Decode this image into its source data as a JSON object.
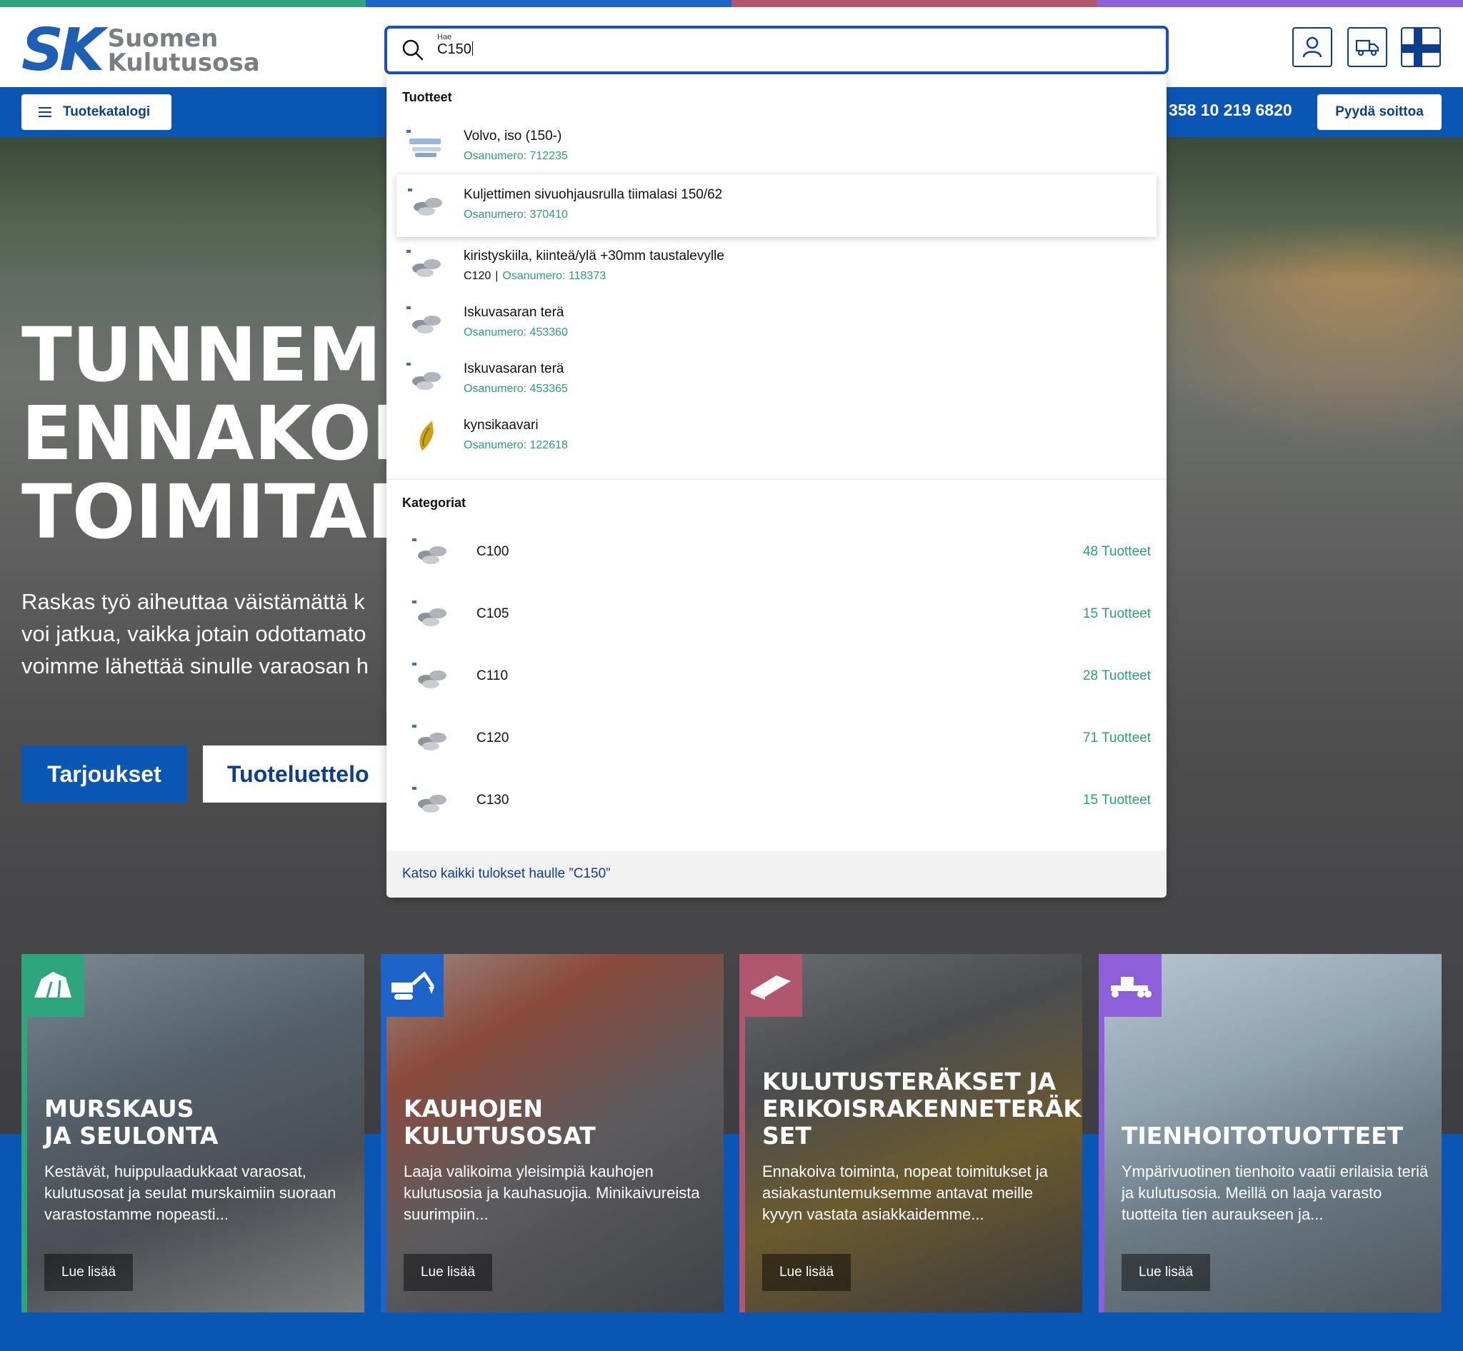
{
  "colors": {
    "stripe": [
      "#2fa57e",
      "#1d63c8",
      "#b0566e",
      "#8d5fd9"
    ],
    "brand_blue": "#0a56b4",
    "accent_green": "#2aa077",
    "search_border": "#1a4fc4"
  },
  "header": {
    "logo": {
      "mark": "SK",
      "line1": "Suomen",
      "line2": "Kulutusosa"
    },
    "search": {
      "small_label": "Hae",
      "value": "C150"
    },
    "icons": [
      "user-icon",
      "delivery-truck-icon",
      "finland-flag-icon"
    ]
  },
  "nav": {
    "catalog_label": "Tuotekatalogi",
    "phone": "358 10 219 6820",
    "call_label": "Pyydä soittoa"
  },
  "hero": {
    "title_lines": [
      "TUNNEMI",
      "ENNAKOI",
      "TOIMITAM"
    ],
    "text_lines": [
      "Raskas työ aiheuttaa väistämättä k",
      "voi jatkua, vaikka jotain odottamato",
      "voimme lähettää sinulle varaosan h"
    ],
    "btn_offers": "Tarjoukset",
    "btn_catalog": "Tuoteluettelo"
  },
  "dropdown": {
    "products_title": "Tuotteet",
    "products": [
      {
        "name": "Volvo, iso (150-)",
        "part_label": "Osanumero:",
        "part_no": "712235",
        "model": ""
      },
      {
        "name": "Kuljettimen sivuohjausrulla tiimalasi 150/62",
        "part_label": "Osanumero:",
        "part_no": "370410",
        "model": ""
      },
      {
        "name": "kiristyskiila, kiinteä/ylä +30mm taustalevylle",
        "part_label": "Osanumero:",
        "part_no": "118373",
        "model": "C120",
        "separator": "|"
      },
      {
        "name": "Iskuvasaran terä",
        "part_label": "Osanumero:",
        "part_no": "453360",
        "model": ""
      },
      {
        "name": "Iskuvasaran terä",
        "part_label": "Osanumero:",
        "part_no": "453365",
        "model": ""
      },
      {
        "name": "kynsikaavari",
        "part_label": "Osanumero:",
        "part_no": "122618",
        "model": ""
      }
    ],
    "categories_title": "Kategoriat",
    "categories": [
      {
        "name": "C100",
        "count": "48 Tuotteet"
      },
      {
        "name": "C105",
        "count": "15 Tuotteet"
      },
      {
        "name": "C110",
        "count": "28 Tuotteet"
      },
      {
        "name": "C120",
        "count": "71 Tuotteet"
      },
      {
        "name": "C130",
        "count": "15 Tuotteet"
      }
    ],
    "see_all": "Katso kaikki tulokset haulle ”C150”"
  },
  "cards": [
    {
      "title_lines": [
        "MURSKAUS",
        "JA SEULONTA"
      ],
      "text": "Kestävät, huippulaadukkaat varaosat, kulutusosat ja seulat murskaimiin suoraan varastostamme nopeasti...",
      "more": "Lue lisää",
      "accent": "#2fa57e",
      "icon": "crusher-rocks-icon"
    },
    {
      "title_lines": [
        "KAUHOJEN",
        "KULUTUSOSAT"
      ],
      "text": "Laaja valikoima yleisimpiä kauhojen kulutusosia ja kauhasuojia. Minikaivureista suurimpiin...",
      "more": "Lue lisää",
      "accent": "#1d63c8",
      "icon": "excavator-icon"
    },
    {
      "title_lines": [
        "KULUTUSTERÄKSET JA",
        "ERIKOISRAKENNETERÄK",
        "SET"
      ],
      "text": "Ennakoiva toiminta, nopeat toimitukset ja asiakastuntemuksemme antavat meille kyvyn vastata asiakkaidemme...",
      "more": "Lue lisää",
      "accent": "#b0566e",
      "icon": "steel-plate-icon"
    },
    {
      "title_lines": [
        "TIENHOITOTUOTTEET"
      ],
      "text": "Ympärivuotinen tienhoito vaatii erilaisia teriä ja kulutusosia. Meillä on laaja varasto tuotteita tien auraukseen ja...",
      "more": "Lue lisää",
      "accent": "#8d5fd9",
      "icon": "road-grader-icon"
    }
  ]
}
